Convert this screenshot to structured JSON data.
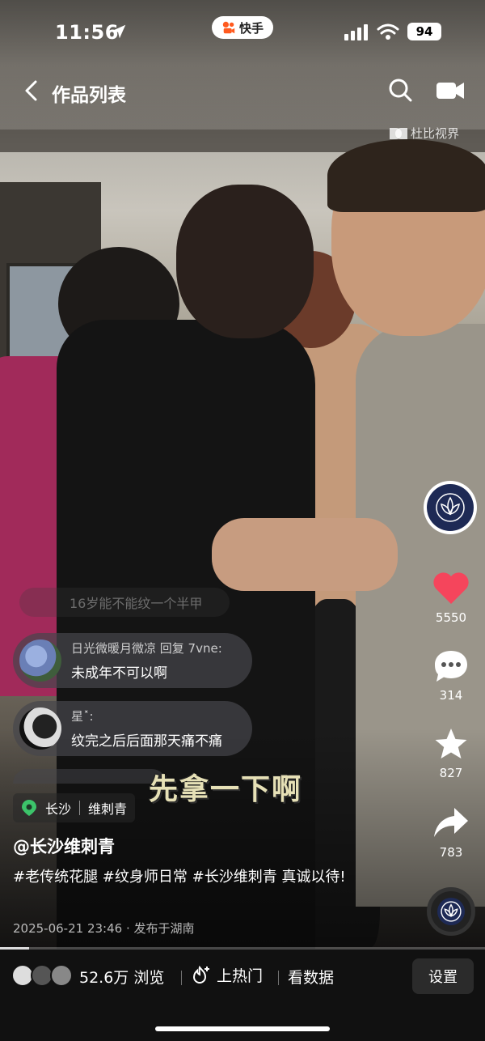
{
  "status_bar": {
    "time": "11:56",
    "app_name": "快手",
    "battery": "94",
    "icons": [
      "location-arrow-icon",
      "kuaishou-logo-icon",
      "signal-icon",
      "wifi-icon",
      "battery-icon"
    ]
  },
  "nav": {
    "title": "作品列表",
    "icons": [
      "back-icon",
      "search-icon",
      "video-icon"
    ]
  },
  "dolby": {
    "label": "杜比视界"
  },
  "side_rail": {
    "like_count": "5550",
    "comment_count": "314",
    "favorite_count": "827",
    "share_count": "783",
    "icons": [
      "heart-icon",
      "comment-icon",
      "star-icon",
      "share-icon",
      "music-disc-icon"
    ],
    "colors": {
      "like": "#f5455c"
    }
  },
  "comments": {
    "faded_text": "16岁能不能纹一个半甲",
    "items": [
      {
        "meta": "日光微暖月微凉 回复 7vne:",
        "text": "未成年不可以啊"
      },
      {
        "meta": "星˟:",
        "text": "纹完之后后面那天痛不痛"
      }
    ]
  },
  "subtitle": "先拿一下啊",
  "video_info": {
    "location": "长沙",
    "location_tag": "维刺青",
    "author": "@长沙维刺青",
    "caption": "#老传统花腿 #纹身师日常 #长沙维刺青 真诚以待!",
    "date": "2025-06-21 23:46",
    "published_from": "· 发布于湖南"
  },
  "bottom_bar": {
    "views": "52.6万 浏览",
    "hot_label": "上热门",
    "data_label": "看数据",
    "settings_label": "设置"
  }
}
